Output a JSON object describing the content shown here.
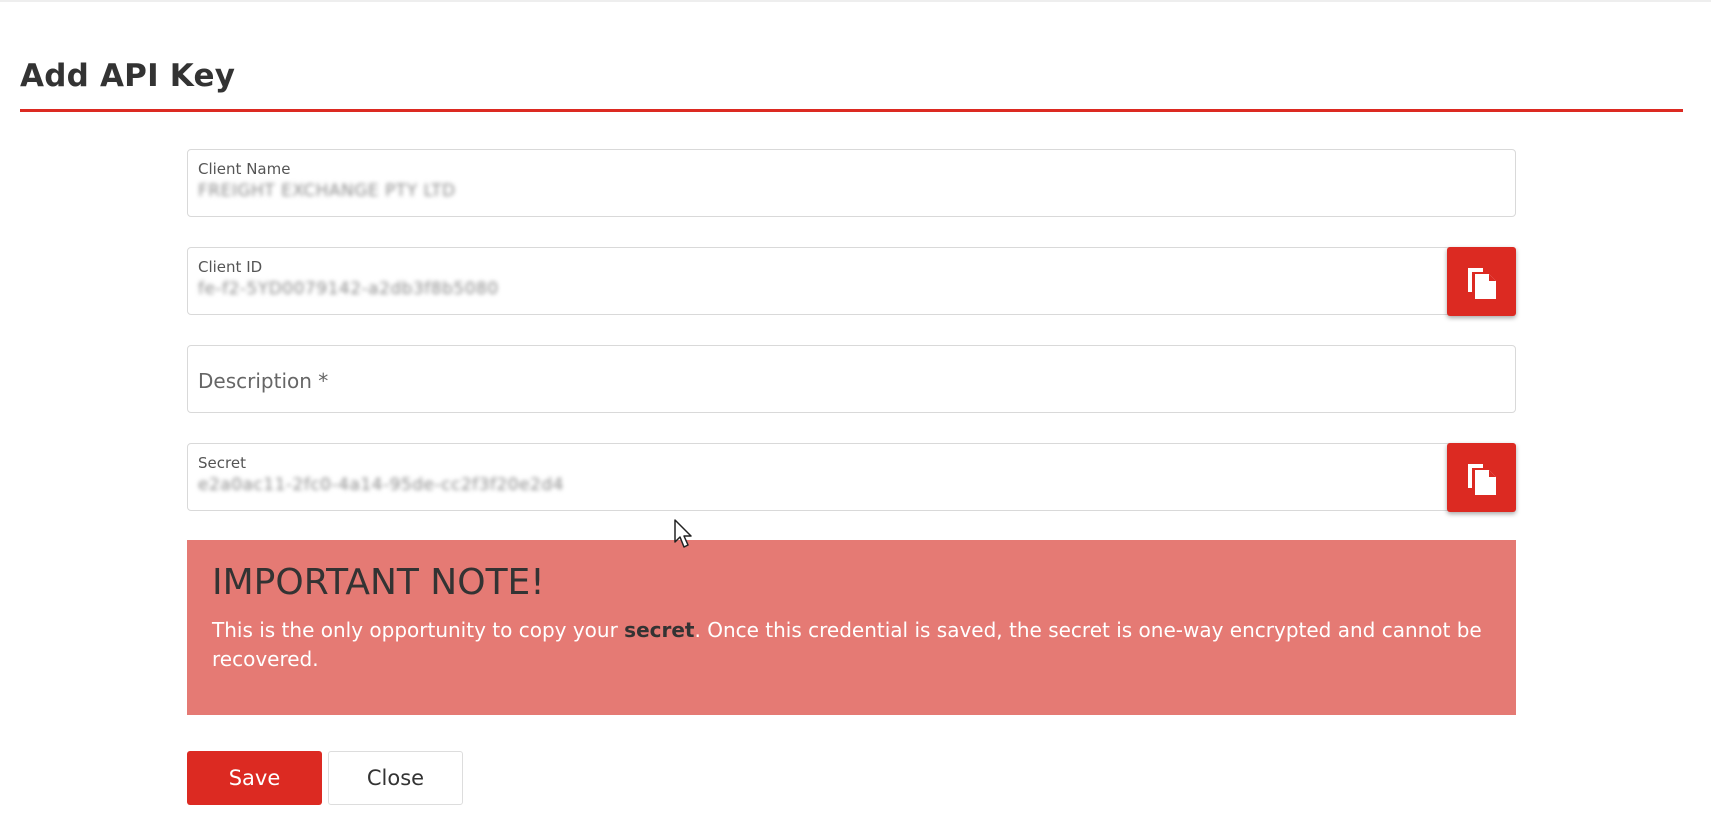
{
  "page": {
    "title": "Add API Key"
  },
  "form": {
    "client_name": {
      "label": "Client Name",
      "value": "FREIGHT EXCHANGE PTY LTD"
    },
    "client_id": {
      "label": "Client ID",
      "value": "fe-f2-5YD0079142-a2db3f8b5080"
    },
    "description": {
      "placeholder": "Description *"
    },
    "secret": {
      "label": "Secret",
      "value": "e2a0ac11-2fc0-4a14-95de-cc2f3f20e2d4"
    }
  },
  "note": {
    "title": "IMPORTANT NOTE!",
    "text_before": "This is the only opportunity to copy your ",
    "text_bold": "secret",
    "text_after": ". Once this credential is saved, the secret is one-way encrypted and cannot be recovered."
  },
  "actions": {
    "save_label": "Save",
    "close_label": "Close"
  },
  "colors": {
    "accent": "#dc2a22",
    "note_background": "#e57a74"
  },
  "icons": {
    "copy": "copy-icon",
    "cursor": "mouse-pointer-icon"
  }
}
